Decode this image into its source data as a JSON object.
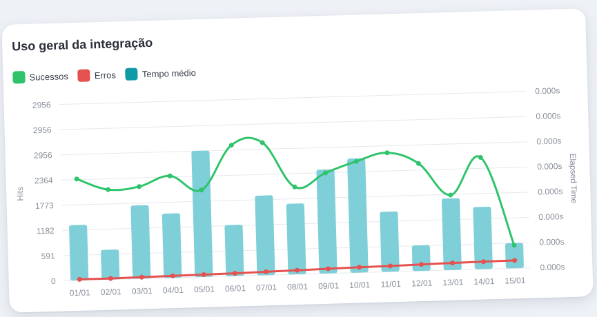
{
  "card": {
    "title": "Uso geral da integração"
  },
  "colors": {
    "success": "#2fc46b",
    "error": "#e5514f",
    "time": "#0e9aa7",
    "bar_fill": "#7fcfd8",
    "grid": "#e6e8ec"
  },
  "legend": [
    {
      "label": "Sucessos",
      "color": "#2fc46b"
    },
    {
      "label": "Erros",
      "color": "#e5514f"
    },
    {
      "label": "Tempo médio",
      "color": "#0e9aa7"
    }
  ],
  "chart_data": {
    "type": "bar",
    "categories": [
      "01/01",
      "02/01",
      "03/01",
      "04/01",
      "05/01",
      "06/01",
      "07/01",
      "08/01",
      "09/01",
      "10/01",
      "11/01",
      "12/01",
      "13/01",
      "14/01",
      "15/01"
    ],
    "ylabel": "Hits",
    "y2label": "Elapsed Time",
    "y_ticks": [
      "0",
      "591",
      "1182",
      "1773",
      "2364",
      "2956",
      "2956",
      "2956"
    ],
    "y2_ticks": [
      "0.000s",
      "0.000s",
      "0.000s",
      "0.000s",
      "0.000s",
      "0.000s",
      "0.000s",
      "0.000s"
    ],
    "ylim": [
      0,
      4138
    ],
    "grid": true,
    "legend_position": "top-left",
    "series": [
      {
        "name": "Tempo médio",
        "type": "bar",
        "values": [
          1300,
          700,
          1720,
          1510,
          2960,
          1200,
          1870,
          1660,
          2440,
          2680,
          1410,
          600,
          1680,
          1460,
          590
        ]
      },
      {
        "name": "Sucessos",
        "type": "line",
        "values": [
          2380,
          2110,
          2160,
          2390,
          2040,
          3070,
          3110,
          2050,
          2360,
          2610,
          2790,
          2520,
          1760,
          2620,
          540
        ]
      },
      {
        "name": "Erros",
        "type": "line",
        "values": [
          25,
          25,
          35,
          45,
          55,
          65,
          80,
          95,
          110,
          125,
          135,
          150,
          165,
          175,
          185
        ]
      }
    ]
  }
}
